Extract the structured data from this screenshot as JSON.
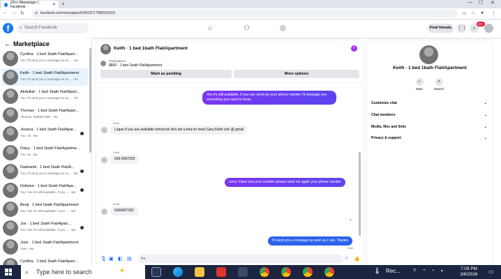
{
  "browser": {
    "tab_title": "(20+) Messenger | Facebook",
    "tab_close": "✕",
    "new_tab": "+",
    "url": "facebook.com/messages/t/24603717585903159"
  },
  "fb_header": {
    "search_placeholder": "Search Facebook",
    "find_friends": "Find friends",
    "notif_badge": "20+"
  },
  "sidebar": {
    "title": "Marketplace",
    "chats": [
      {
        "name": "Cynthia · 1 bed 1bath Flat/Apart...",
        "sub": "You: I'll send you a message as so... · 1m",
        "active": false,
        "dot": false
      },
      {
        "name": "Keith · 1 bed 1bath Flat/Apartment",
        "sub": "You: I'll send you a message as so... · 1m",
        "active": true,
        "dot": false
      },
      {
        "name": "Abdullah · 1 bed 1bath Flat/Apart...",
        "sub": "You: I'll send you a message as so... · 1m",
        "active": false,
        "dot": false
      },
      {
        "name": "Thomas · 1 bed 1bath Flat/Apart...",
        "sub": "Thomas: 9099927887 · 5w",
        "active": false,
        "dot": false
      },
      {
        "name": "Jessica · 1 bed 1bath Flat/Apar...",
        "sub": "You: ok · 5w",
        "active": false,
        "dot": true
      },
      {
        "name": "Daisy · 1 bed 1bath Flat/Apartme...",
        "sub": "You: ok · 5w",
        "active": false,
        "dot": false
      },
      {
        "name": "Dadnaniti · 1 bed 1bath Flat/A...",
        "sub": "You: I'll send you a message as so... · 5w",
        "active": false,
        "dot": true
      },
      {
        "name": "Dollytee · 1 bed 1bath Flat/Apa...",
        "sub": "You: Yes it's still available. If you ... · 5w",
        "active": false,
        "dot": true
      },
      {
        "name": "Benji · 1 bed 1bath Flat/Apartment",
        "sub": "You: Yes it's still available. If you ... · 5w",
        "active": false,
        "dot": false
      },
      {
        "name": "Jos · 1 bed 1bath Flat/Apart...",
        "sub": "You: Yes it's still available. If you ... · 5w",
        "active": false,
        "dot": true
      },
      {
        "name": "Jose · 1 bed 1bath Flat/Apartment",
        "sub": "Jose · 5w",
        "active": false,
        "dot": false
      },
      {
        "name": "Cynthia · 1 bed 1bath Flat/Apart...",
        "sub": "",
        "active": false,
        "dot": false
      }
    ]
  },
  "conversation": {
    "title": "Keith · 1 bed 1bath Flat/Apartment",
    "marketplace_label": "Marketplace",
    "listing": "$600 · 1 bed 1bath Flat/Apartment",
    "mark_pending": "Mark as pending",
    "more_options": "More options",
    "messages": [
      {
        "from": "me",
        "text": "Yes it's still available. If you can send me your phone number I'll message you everything you need to know"
      },
      {
        "from": "Keith",
        "text": "Logan if you are available tomorrow let's set a time to meet Gary Keith oo5 @ gmail"
      },
      {
        "from": "Keith",
        "text": "626-6657292"
      },
      {
        "from": "me",
        "text": "sorry i have lose your number please send me again your phone number"
      },
      {
        "from": "Keith",
        "text": "6266657292"
      },
      {
        "from": "me",
        "text": "I'll send you a message as soon as I can. Thanks"
      }
    ],
    "sender_name": "Keith",
    "seen_label": "Sent",
    "input_placeholder": "Aa"
  },
  "info_pane": {
    "name": "Keith · 1 bed 1bath Flat/Apartment",
    "mute": "Mute",
    "search": "Search",
    "sections": [
      "Customize chat",
      "Chat members",
      "Media, files and links",
      "Privacy & support"
    ]
  },
  "taskbar": {
    "search_placeholder": "Type here to search",
    "tray_label": "Rec...",
    "time": "7:09 PM",
    "date": "3/6/2026"
  },
  "colors": {
    "fb_blue": "#1877f2",
    "accent_purple": "#7b2ff7",
    "badge_red": "#e41e3f",
    "taskbar": "#1b2540"
  }
}
